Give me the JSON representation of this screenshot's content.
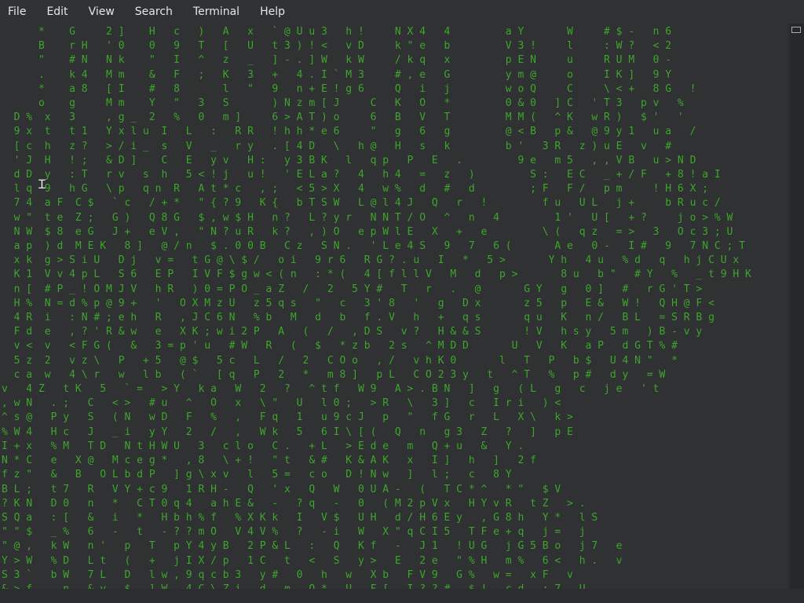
{
  "menubar": {
    "items": [
      "File",
      "Edit",
      "View",
      "Search",
      "Terminal",
      "Help"
    ]
  },
  "terminal": {
    "lines": [
      "      *    G     2 ]    H   c   )   A   x   ` @ U u 3   h !     N X 4   4         a Y       W     # $ -   n 6",
      "      B    r H   ' 0    0   9   T   [   U   t 3 ) ! <   v D     k \" e   b         V 3 !     l     : W ?   < 2",
      "      \"    # N   N k    \"   I   ^   z   _   ] - . ] W   k W     / k q   x         p E N     u     R U M   0 -",
      "      .    k 4   M m    &   F   ;   K   3   +   4 . I ` M 3     # , e   G         y m @     o     I K ]   9 Y",
      "      *    a 8   [ I    #   8       l   \"   9   n + E ! g 6     Q   i   j         w o Q     C     \\ < +   8 G   !",
      "      o    g     M m    Y   \"   3   S       ) N z m [ J     C   K   O   *         0 & 0   ] C   ' T 3   p v   %",
      "  D %  x   3     , g _  2   %   0   m ]     6 > A T ) o     6   B   V   T         M M (   ^ K   w R )   $ '   '",
      "  9 x  t   t 1   Y x l u  I   L   :   R R   ! h h * e 6     \"   g   6   g         @ < B   p &   @ 9 y 1   u a   /",
      "  [ c  h   z ?   > / i _  s   V   _   r y   . [ 4 D   \\   h @   H   s   k         b '   3 R   z ) u E   v   #",
      "  ' J  H   ! ;   & D ]    C   E   y v   H :   y 3 B K   l   q p   P   E   .         9 e   m 5   , , V B   u > N D",
      "  d D  y   : T   r v   s  h   5 < ! j   u !   ' E L a ?   4   h 4   =   z   )         S :   E C   _ + / F   + 8 ! a I",
      "  l q  9   h G   \\ p   q n  R   A t * c   , ;   < 5 > X   4   w %   d   #   d         ; F   F /   p m     ! H 6 X ;",
      "  7 4  a F  C $   ` c   / + *   \" { ? 9   K {   b T S W   L @ l 4 J   Q   r   !         f u   U L   j +     b R u c /",
      "  w \"  t e  Z ;   G )   Q 8 G   $ , w $ H   n ?   L ? y r   N N T / O   ^   n   4         1 '   U [   + ?     j o > % W",
      "  N W  $ 8  e G   J +   e V ,   \" N ? u R   k ?   , ) O   e p W l E   X   +   e         \\ (   q z   = >   3   O c 3 ; U",
      "  a p  ) d  M E K   8 ]   @ / n   $ . 0 0 B   C z   S N .   ' L e 4 S   9   7   6 (       A e   0 -   I #   9   7 N C ; T",
      "  x k  g > S i U   D j   v =   t G @ \\ $ /   o i   9 r 6   R G ? . u   I   *   5 >       Y h   4 u   % d   q   h j C U x",
      "  K 1  V v 4 p L   S 6   E P   I V F $ g w < ( n   : * (   4 [ f l l V   M   d   p >       8 u   b \"   # Y   %   _ t 9 H K",
      "  n [  # P _ ! O M J V   h R   ) 0 = P O _ a Z   /   2   5 Y #   T   r   .   @       G Y   g   0 ]   #   r G ' T >",
      "  H %  N = d % p @ 9 +   '   O X M z U   z 5 q s   \"   c   3 ' 8   '   g   D x       z 5   p   E &   W !   Q H @ F <",
      "  4 R  i   : N # ; e h   R   , J C 6 N   % b   M   d   b   f . V   h   +   q s       q u   K   n /   B L   = S R B g",
      "  F d  e   , ? ' R & w   e   X K ; w i 2 P   A   (   /   , D S   v ?   H & & S       ! V   h s y   5 m   ) B - v y",
      "  v <  v   < F G (   &   3 = p ' u   # W   R   (   $   * z b   2 s   ^ M D D       U   V   K   a P   d G T % #",
      "  5 z  2   v z \\   P   + 5   @ $   5 c   L   /   2   C O o   , /   v h K 0       l   T   P   b $   U 4 N \"   *",
      "  c a  w   4 \\ r   w   l b   ( `   [ q   P   2   *   m 8 ]   p L   C O 2 3 y   t   ^ T   %   p #   d y   = W",
      "v   4 Z   t K   5   ` =   > Y   k a   W   2   ?   ^ t f   W 9   A > . B N   ]   g   ( L   g   c   j e   ' t",
      ", w N   . ;   C   < >   # u   ^   O   x   \\ \"   U   l 0 ;   > R   \\   3 ]   c   I r i   ) <",
      "^ s @   P y   S   ( N   w D   F   %   ,   F q   1   u 9 c J   p   \"   f G   r   L   X \\   k >",
      "% W 4   H c   J   _ i   y Y   2   /   ,   W k   5   6 I \\ [ (   Q   n   g 3   Z   ?   ]   p E",
      "I + x   % M   T D   N t H W U   3   c l o   C .   + L   > E d e   m   Q + u   &   Y .",
      "N * C   e   X @   M c e g *   , 8   \\ + !   \" t   & #   K & A K   x   I ]   h   ]   2 f",
      "f z \"   &   B   O L b d P   ] g \\ x v   l   5 =   c o   D ! N w   ]   l ;   c   8 Y",
      "B L ;   t 7   R   V Y + c 9   1 R H -   Q   ' x   Q   W   0 U A -   (   T C * ^   * \"   $ V",
      "? K N   D 0   n   *   C T 0 q 4   a h E &   -   ? q   -   0   ( M 2 p V x   H Y v R   t Z   > .",
      "S Q a   : [   &   i   *   H b h % f   % X K k   I   V $   U H   d / H 6 E y   , G 8 h   Y *   l S",
      "\" \" $   _ %   6   -   t   - ? ? m O   V 4 V %   ?   - i   W   X \" q C I 5   T F e + q   j =   j",
      "\" @ ,   k W   n '   p   T   p Y 4 y B   2 P & L   :   Q   K f   -   J 1   ! U G   j G 5 B o   j 7   e",
      "Y > W   % D   L t   (   +   j I X / p   1 C   t   <   S   y >   E   2 e   \" % H   m %   6 <   h .   v",
      "S 3 `   b W   7 L   D   l w , 9 q c b 3   y #   0   h   w   X b   F V 9   G %   w =   x F   v",
      "& > f   . n   & v   $   ] W _ 4 C \\ Z i   d   m   O *   U   F [   I ? ? #   $ !   c d   : 7   U"
    ]
  }
}
